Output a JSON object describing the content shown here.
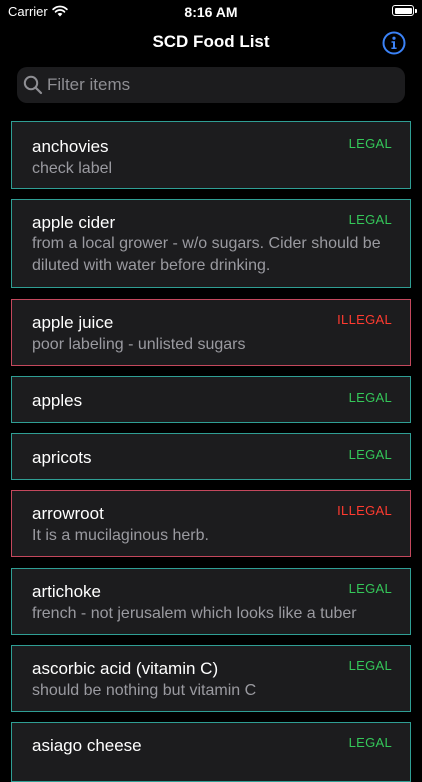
{
  "status_bar": {
    "carrier": "Carrier",
    "time": "8:16 AM"
  },
  "nav": {
    "title": "SCD Food List",
    "info_icon": "info-icon"
  },
  "search": {
    "placeholder": "Filter items",
    "value": "",
    "icon": "search-icon"
  },
  "colors": {
    "legal": "#34c759",
    "illegal": "#ff3b30",
    "legal_border": "#2f9e94",
    "illegal_border": "#c4485d"
  },
  "items": [
    {
      "name": "anchovies",
      "note": "check label",
      "status": "LEGAL"
    },
    {
      "name": "apple cider",
      "note": "from a local grower - w/o sugars. Cider should be diluted with water before drinking.",
      "status": "LEGAL"
    },
    {
      "name": "apple juice",
      "note": "poor labeling - unlisted sugars",
      "status": "ILLEGAL"
    },
    {
      "name": "apples",
      "note": "",
      "status": "LEGAL"
    },
    {
      "name": "apricots",
      "note": "",
      "status": "LEGAL"
    },
    {
      "name": "arrowroot",
      "note": "It is a mucilaginous herb.",
      "status": "ILLEGAL"
    },
    {
      "name": "artichoke",
      "note": "french - not jerusalem which looks like a tuber",
      "status": "LEGAL"
    },
    {
      "name": "ascorbic acid (vitamin C)",
      "note": "should be nothing but vitamin C",
      "status": "LEGAL"
    },
    {
      "name": "asiago cheese",
      "note": "",
      "status": "LEGAL"
    }
  ]
}
